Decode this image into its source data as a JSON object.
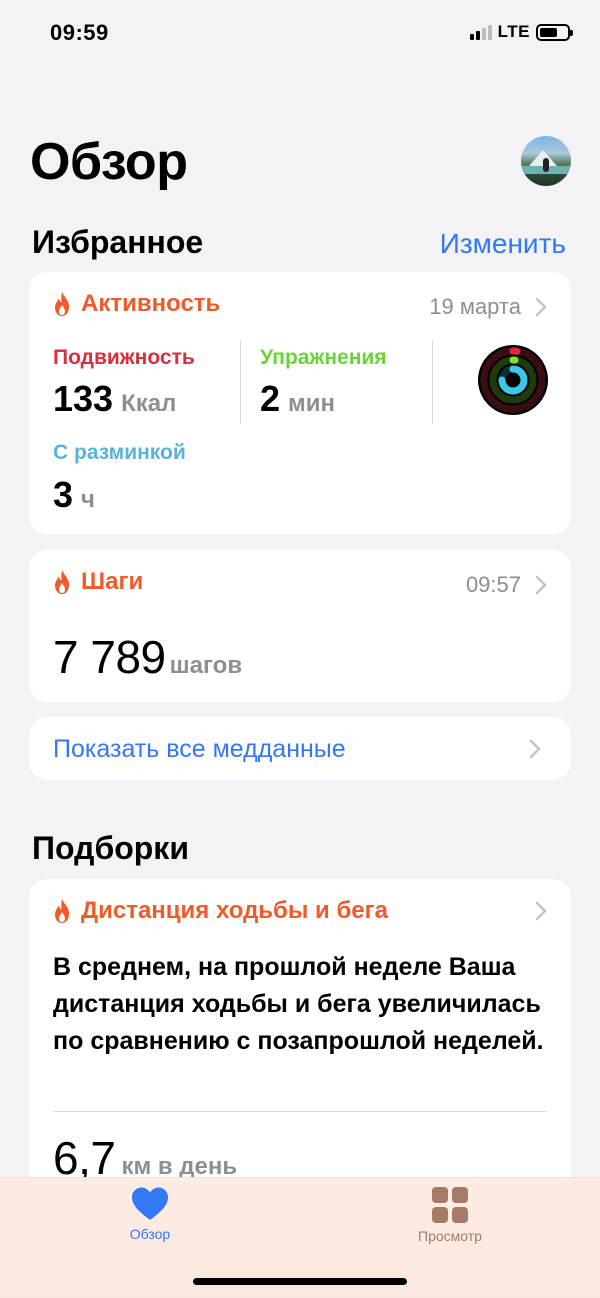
{
  "status_bar": {
    "time": "09:59",
    "network": "LTE"
  },
  "header": {
    "title": "Обзор"
  },
  "favorites": {
    "title": "Избранное",
    "edit_label": "Изменить",
    "activity": {
      "title": "Активность",
      "date": "19 марта",
      "move": {
        "label": "Подвижность",
        "value": "133",
        "unit": "Ккал",
        "color": "#d6313c"
      },
      "exercise": {
        "label": "Упражнения",
        "value": "2",
        "unit": "мин",
        "color": "#6ad33a"
      },
      "stand": {
        "label": "С разминкой",
        "value": "3",
        "unit": "ч",
        "color": "#5ab4d9"
      }
    },
    "steps": {
      "title": "Шаги",
      "time": "09:57",
      "value": "7 789",
      "unit": "шагов"
    },
    "show_all_label": "Показать все медданные"
  },
  "highlights": {
    "title": "Подборки",
    "card": {
      "title": "Дистанция ходьбы и бега",
      "text": "В среднем, на прошлой неделе Ваша дистанция ходьбы и бега увеличилась по сравнению с позапрошлой неделей.",
      "value": "6,7",
      "unit": "км в день"
    }
  },
  "tabbar": {
    "tabs": [
      {
        "label": "Обзор",
        "icon": "heart-icon",
        "active": true
      },
      {
        "label": "Просмотр",
        "icon": "grid-icon",
        "active": false
      }
    ]
  },
  "colors": {
    "accent": "#3478f6",
    "health_orange": "#f05b2a",
    "tab_inactive": "#a57a66"
  }
}
